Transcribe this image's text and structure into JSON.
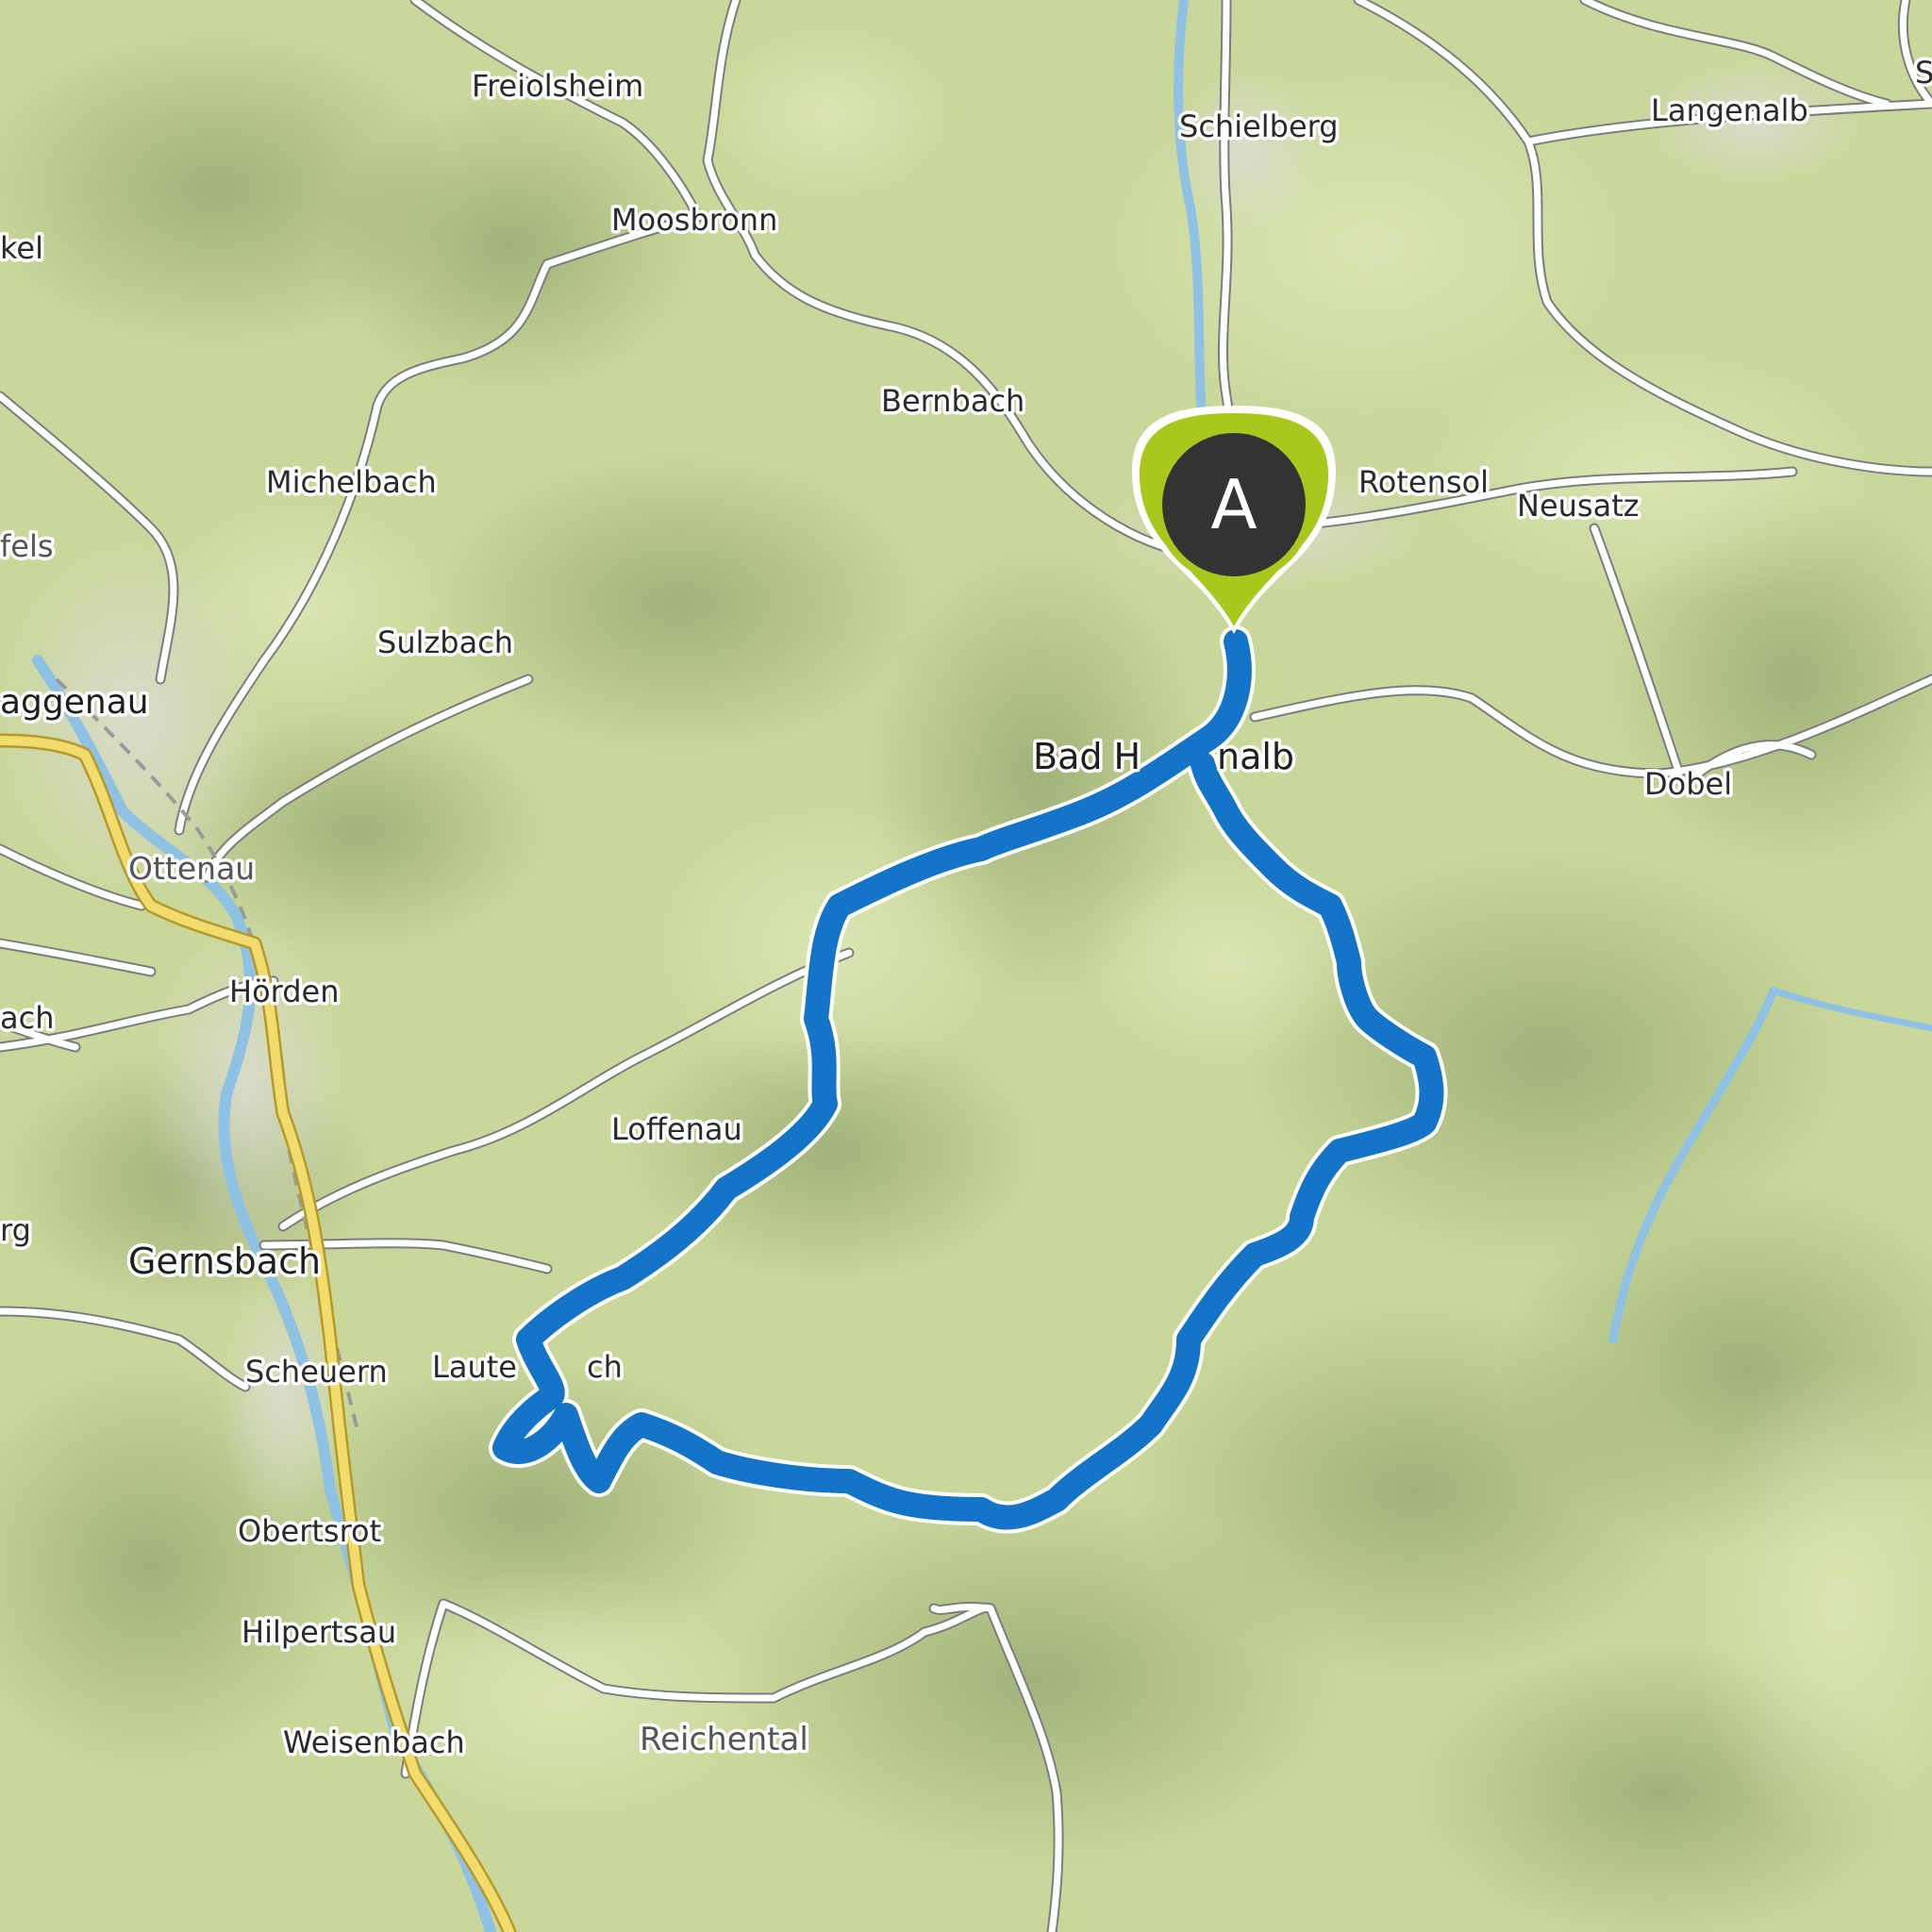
{
  "map": {
    "start_marker": {
      "label": "A"
    },
    "places": {
      "freiolsheim": "Freiolsheim",
      "schielberg": "Schielberg",
      "langenalb": "Langenalb",
      "s_partial": "S",
      "moosbronn": "Moosbronn",
      "kel": "kel",
      "bernbach": "Bernbach",
      "michelbach": "Michelbach",
      "rotensol": "Rotensol",
      "neusatz": "Neusatz",
      "fels": "fels",
      "sulzbach": "Sulzbach",
      "gaggenau": "aggenau",
      "bad_herrenalb": "Bad H",
      "bad_herrenalb_end": "nalb",
      "dobel": "Dobel",
      "ottenau": "Ottenau",
      "hoerden": "Hörden",
      "bach": "ach",
      "loffenau": "Loffenau",
      "rg": "rg",
      "gernsbach": "Gernsbach",
      "scheuern": "Scheuern",
      "lautenbach": "Laute",
      "lautenbach_end": "ch",
      "obertsrot": "Obertsrot",
      "hilpertsau": "Hilpertsau",
      "weisenbach": "Weisenbach",
      "reichental": "Reichental"
    },
    "colors": {
      "terrain": "#c9d79a",
      "forest": "#b9cc86",
      "route": "#1474c8",
      "marker_pin": "#a8c81e",
      "marker_head": "#333333",
      "river": "#8fc1e4",
      "main_road": "#f2dc6e"
    }
  }
}
